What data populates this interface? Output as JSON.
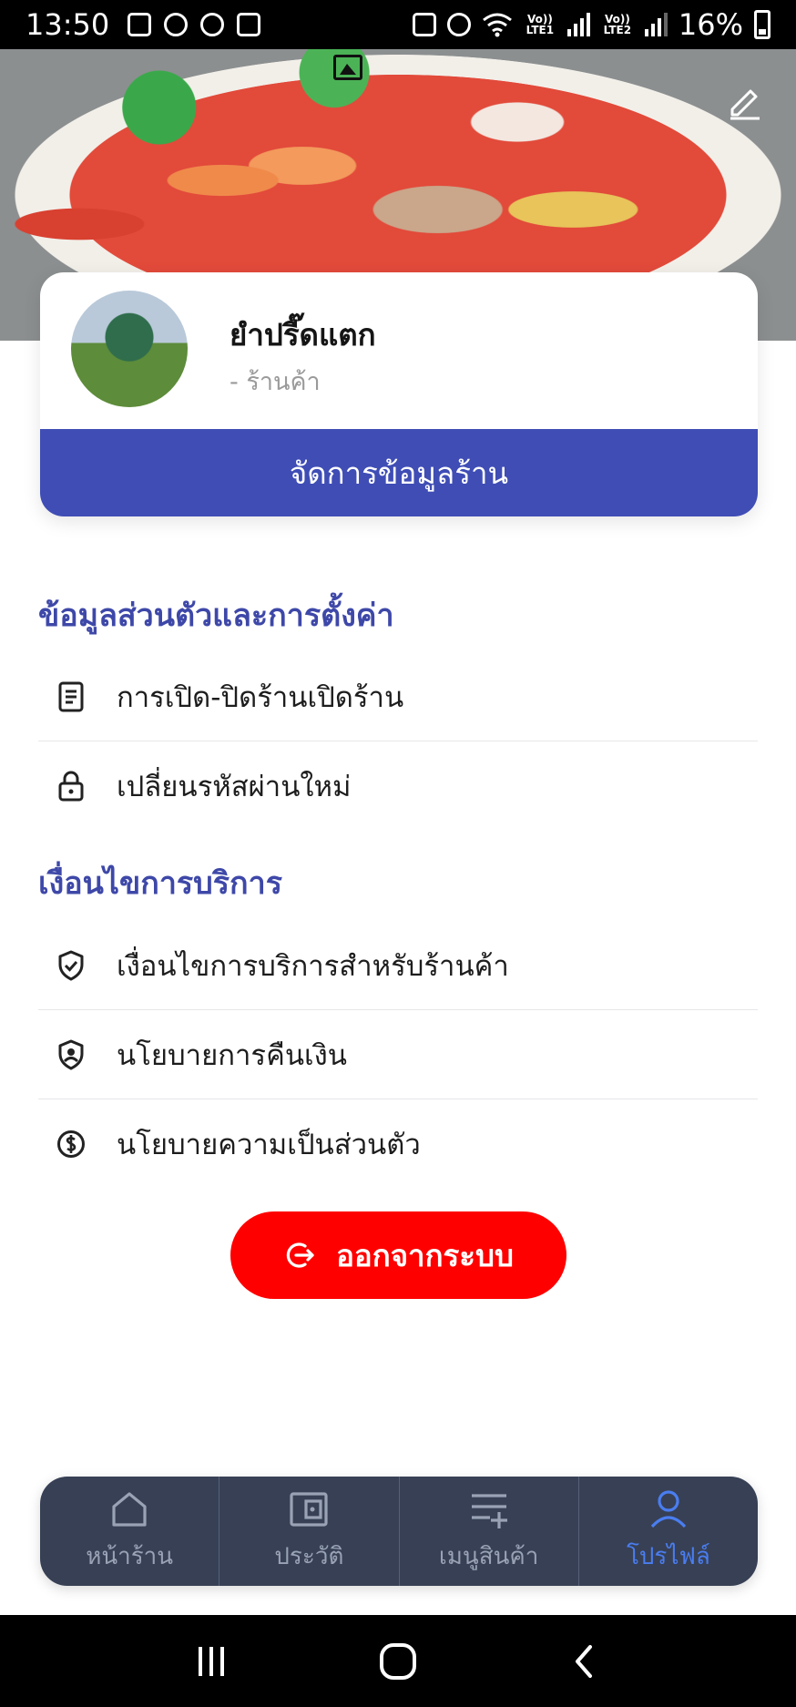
{
  "status_bar": {
    "time": "13:50",
    "net1": "Vo)) LTE1",
    "net2": "Vo)) LTE2",
    "battery": "16%"
  },
  "profile": {
    "shop_name": "ยำปรี๊ดแตก",
    "shop_type": "- ร้านค้า",
    "manage_button": "จัดการข้อมูลร้าน"
  },
  "sections": {
    "personal": {
      "title": "ข้อมูลส่วนตัวและการตั้งค่า",
      "items": [
        {
          "label": "การเปิด-ปิดร้านเปิดร้าน",
          "icon": "document-icon"
        },
        {
          "label": "เปลี่ยนรหัสผ่านใหม่",
          "icon": "lock-icon"
        }
      ]
    },
    "terms": {
      "title": "เงื่อนไขการบริการ",
      "items": [
        {
          "label": "เงื่อนไขการบริการสำหรับร้านค้า",
          "icon": "shield-check-icon"
        },
        {
          "label": "นโยบายการคืนเงิน",
          "icon": "shield-user-icon"
        },
        {
          "label": "นโยบายความเป็นส่วนตัว",
          "icon": "dollar-circle-icon"
        }
      ]
    }
  },
  "logout": {
    "label": "ออกจากระบบ"
  },
  "bottom_nav": {
    "items": [
      {
        "label": "หน้าร้าน",
        "icon": "home-icon"
      },
      {
        "label": "ประวัติ",
        "icon": "wallet-icon"
      },
      {
        "label": "เมนูสินค้า",
        "icon": "playlist-add-icon"
      },
      {
        "label": "โปรไฟล์",
        "icon": "user-icon",
        "active": true
      }
    ]
  },
  "colors": {
    "accent": "#3f4db5",
    "section_title": "#3e48a8",
    "logout": "#ff0000",
    "nav_bg": "#374055",
    "nav_active": "#4a7df0"
  }
}
